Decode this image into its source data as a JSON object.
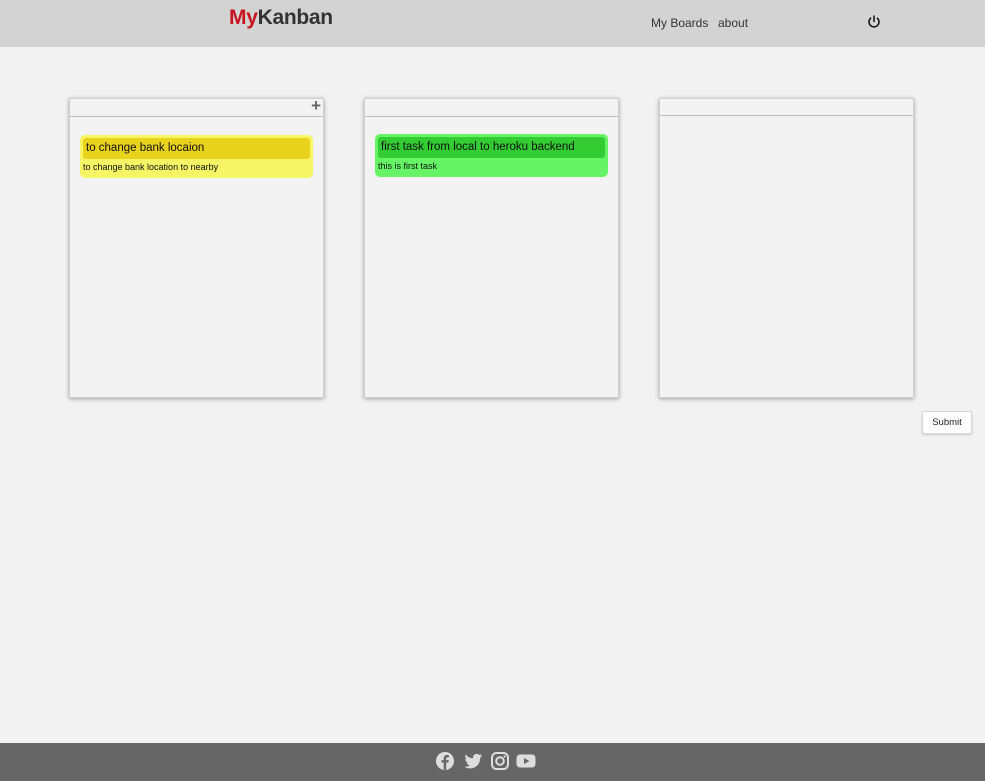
{
  "header": {
    "logo_my": "My",
    "logo_kanban": "Kanban",
    "nav": {
      "boards_label": "My Boards",
      "about_label": "about"
    },
    "power_icon": "power-icon"
  },
  "columns": [
    {
      "add_label": "+",
      "cards": [
        {
          "title": "to change bank locaion",
          "description": "to change bank location to nearby",
          "color": "#e8d21c",
          "bg": "#f5f565"
        }
      ]
    },
    {
      "cards": [
        {
          "title": "first task from local to heroku backend",
          "description": "this is first task",
          "color": "#33cc33",
          "bg": "#66f466"
        }
      ]
    },
    {
      "cards": []
    }
  ],
  "actions": {
    "submit_label": "Submit"
  },
  "footer": {
    "icons": [
      "facebook-icon",
      "twitter-icon",
      "instagram-icon",
      "youtube-icon"
    ]
  },
  "colors": {
    "header_bg": "#d3d3d3",
    "footer_bg": "#666666",
    "logo_red": "#c8141e"
  }
}
